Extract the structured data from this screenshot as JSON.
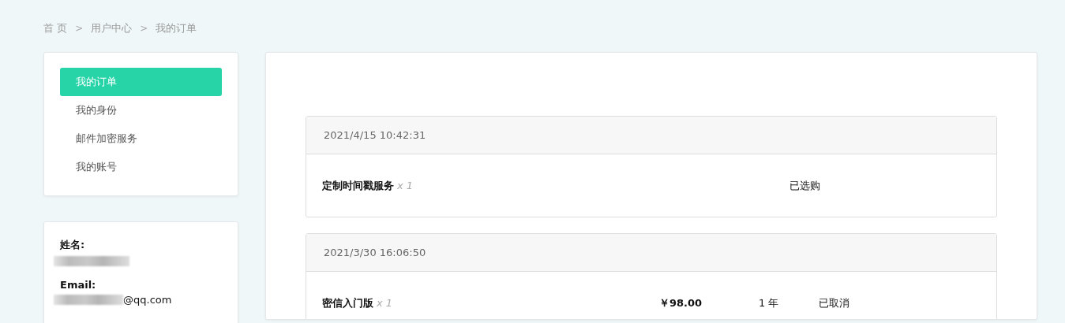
{
  "breadcrumb": [
    {
      "label": "首 页"
    },
    {
      "separator": ">",
      "label": "用户中心"
    },
    {
      "separator": ">",
      "label": "我的订单"
    }
  ],
  "sidebar": {
    "items": [
      {
        "label": "我的订单",
        "selected": true
      },
      {
        "label": "我的身份",
        "selected": false
      },
      {
        "label": "邮件加密服务",
        "selected": false
      },
      {
        "label": "我的账号",
        "selected": false
      }
    ]
  },
  "profile": {
    "fields": [
      {
        "label": "姓名:"
      },
      {
        "label": "Email:",
        "value_suffix": "@qq.com"
      }
    ]
  },
  "orders": [
    {
      "time": "2021/4/15 10:42:31",
      "product": "定制时间戳服务",
      "quantity": "x 1",
      "status": "已选购"
    },
    {
      "time": "2021/3/30 16:06:50",
      "product": "密信入门版",
      "quantity": "x 1",
      "price": "￥98.00",
      "duration": "1 年",
      "status": "已取消"
    }
  ]
}
